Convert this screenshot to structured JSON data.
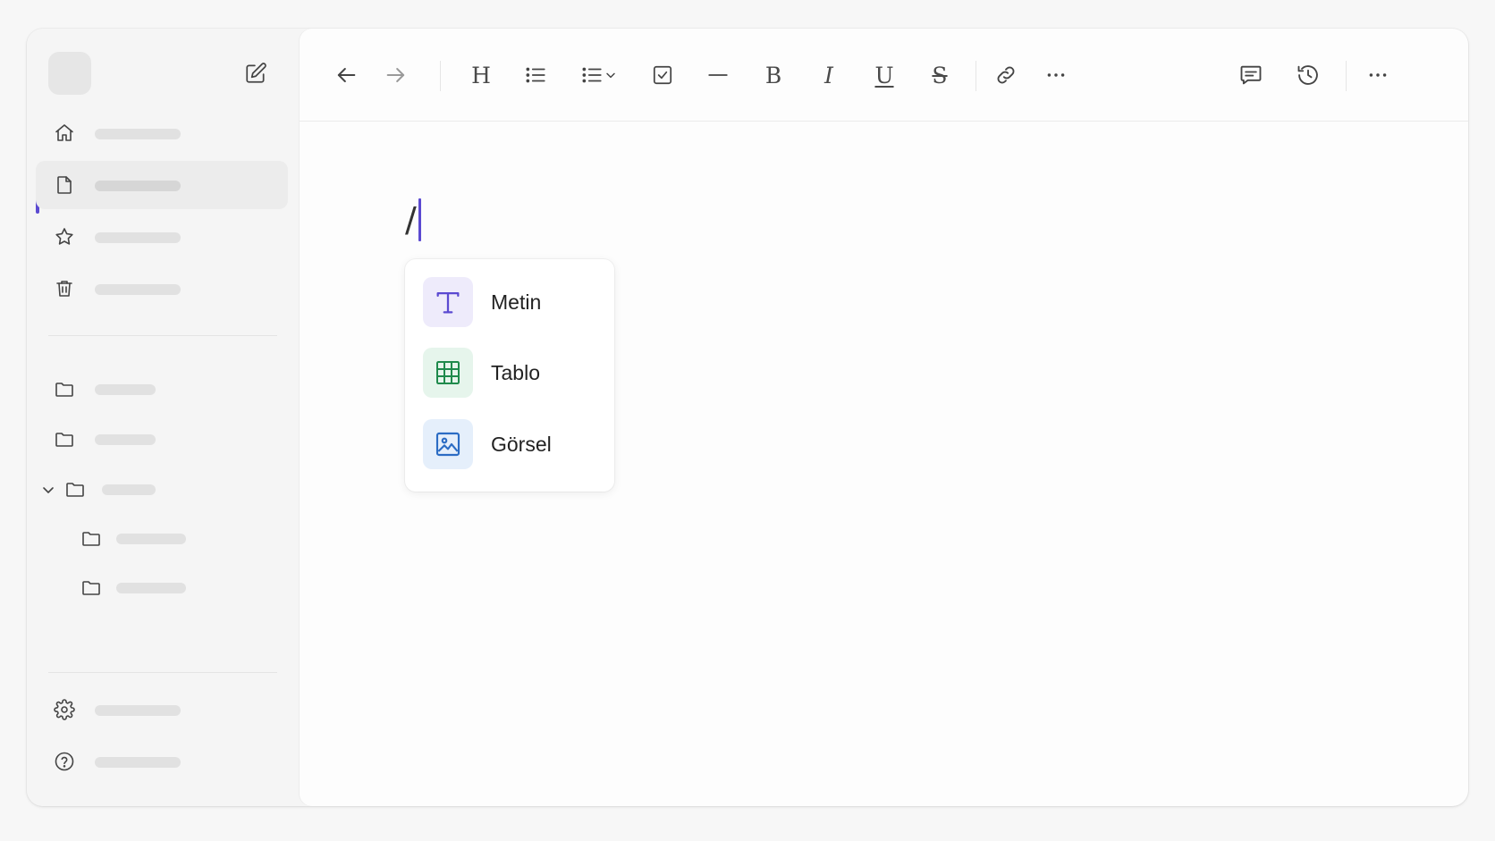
{
  "sidebar": {
    "nav_items": [
      {
        "icon": "home-icon",
        "label": "",
        "active": false
      },
      {
        "icon": "document-icon",
        "label": "",
        "active": true
      },
      {
        "icon": "star-icon",
        "label": "",
        "active": false
      },
      {
        "icon": "trash-icon",
        "label": "",
        "active": false
      }
    ],
    "folders": [
      {
        "icon": "folder-icon",
        "label": "",
        "expanded": false,
        "depth": 0
      },
      {
        "icon": "folder-icon",
        "label": "",
        "expanded": false,
        "depth": 0
      },
      {
        "icon": "folder-icon",
        "label": "",
        "expanded": true,
        "depth": 0
      },
      {
        "icon": "folder-icon",
        "label": "",
        "expanded": false,
        "depth": 1
      },
      {
        "icon": "folder-icon",
        "label": "",
        "expanded": false,
        "depth": 1
      }
    ],
    "footer": [
      {
        "icon": "gear-icon",
        "label": ""
      },
      {
        "icon": "help-icon",
        "label": ""
      }
    ],
    "accent_color": "#5b4ad1"
  },
  "toolbar": {
    "heading_label": "H",
    "bold_label": "B",
    "italic_label": "I",
    "underline_label": "U",
    "strike_label": "S",
    "icons": [
      "arrow-left-icon",
      "arrow-right-icon",
      "heading-icon",
      "bullet-list-icon",
      "list-dropdown-icon",
      "checkbox-icon",
      "divider-line-icon",
      "bold-icon",
      "italic-icon",
      "underline-icon",
      "strikethrough-icon",
      "link-icon",
      "more-icon",
      "comment-icon",
      "history-icon",
      "more-menu-icon"
    ]
  },
  "editor": {
    "typed_text": "/"
  },
  "slash_menu": {
    "items": [
      {
        "label": "Metin",
        "icon": "text-icon",
        "color": "#5b4ad1",
        "bg": "#eeebfb"
      },
      {
        "label": "Tablo",
        "icon": "table-icon",
        "color": "#1f8a4c",
        "bg": "#e6f5ec"
      },
      {
        "label": "Görsel",
        "icon": "image-icon",
        "color": "#2b6cc4",
        "bg": "#e5effb"
      }
    ]
  }
}
